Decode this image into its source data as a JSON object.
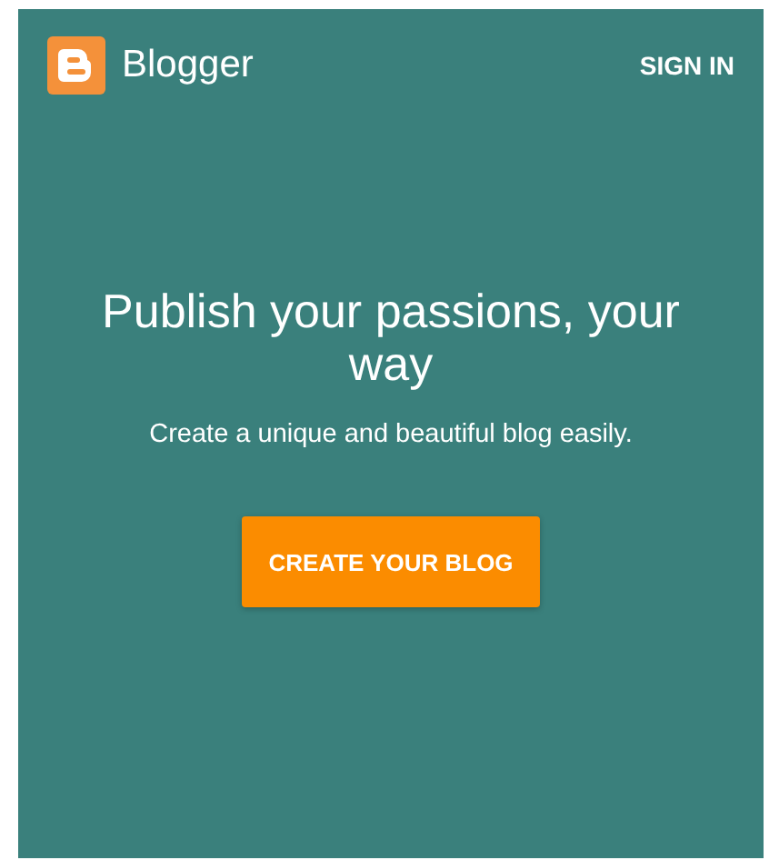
{
  "header": {
    "brand": "Blogger",
    "sign_in": "SIGN IN"
  },
  "hero": {
    "headline": "Publish your passions, your way",
    "subtitle": "Create a unique and beautiful blog easily.",
    "button": "CREATE YOUR BLOG"
  }
}
